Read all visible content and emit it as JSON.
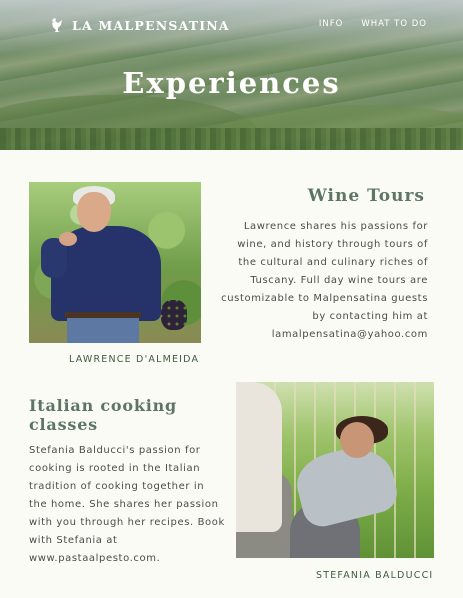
{
  "header": {
    "logo_text": "LA MALPENSATINA",
    "nav": [
      {
        "label": "INFO"
      },
      {
        "label": "WHAT TO DO"
      }
    ],
    "hero_title": "Experiences"
  },
  "sections": {
    "wine": {
      "title": "Wine Tours",
      "body": "Lawrence shares his passions for wine, and history through tours of the cultural and culinary riches of Tuscany. Full day wine tours are customizable to Malpensatina guests by contacting him at lamalpensatina@yahoo.com",
      "photo_caption": "LAWRENCE D'ALMEIDA"
    },
    "cooking": {
      "title": "Italian cooking classes",
      "body": "Stefania Balducci's passion for cooking is rooted in the Italian tradition of cooking together in the home. She shares her passion  with you through her recipes. Book with Stefania at www.pastaalpesto.com.",
      "photo_caption": "STEFANIA BALDUCCI"
    }
  },
  "colors": {
    "background": "#fbfbf6",
    "heading": "#5d7563",
    "caption": "#3f5b3f",
    "text": "#4b4b4b"
  },
  "icons": {
    "logo": "rooster-icon"
  }
}
